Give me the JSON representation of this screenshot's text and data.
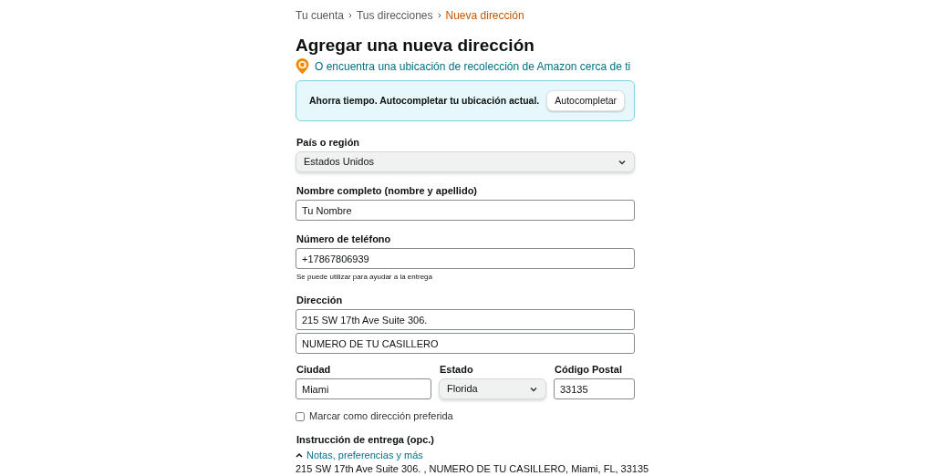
{
  "breadcrumb": [
    {
      "label": "Tu cuenta",
      "selected": false
    },
    {
      "label": "Tus direcciones",
      "selected": false
    },
    {
      "label": "Nueva dirección",
      "selected": true
    }
  ],
  "title": "Agregar una nueva dirección",
  "pickup_link": "O encuentra una ubicación de recolección de Amazon cerca de ti",
  "autocomplete_banner": {
    "text": "Ahorra tiempo. Autocompletar tu ubicación actual.",
    "button": "Autocompletar"
  },
  "country": {
    "label": "País o región",
    "value": "Estados Unidos"
  },
  "full_name": {
    "label": "Nombre completo (nombre y apellido)",
    "value": "Tu Nombre"
  },
  "phone": {
    "label": "Número de teléfono",
    "value": "+17867806939",
    "hint": "Se puede utilizar para ayudar a la entrega"
  },
  "address": {
    "label": "Dirección",
    "line_1": "215 SW 17th Ave Suite 306.",
    "line_2": "NUMERO DE TU CASILLERO"
  },
  "city": {
    "label": "Ciudad",
    "value": "Miami"
  },
  "state": {
    "label": "Estado",
    "value": "Florida"
  },
  "postal_code": {
    "label": "Código Postal",
    "value": "33135"
  },
  "preferred": {
    "label": "Marcar como dirección preferida",
    "checked": false
  },
  "delivery_instructions": {
    "label": "Instrucción de entrega (opc.)",
    "link": "Notas, preferencias y más",
    "expanded": true,
    "summary": "215 SW 17th Ave Suite 306. , NUMERO DE TU CASILLERO, Miami, FL, 33135"
  }
}
